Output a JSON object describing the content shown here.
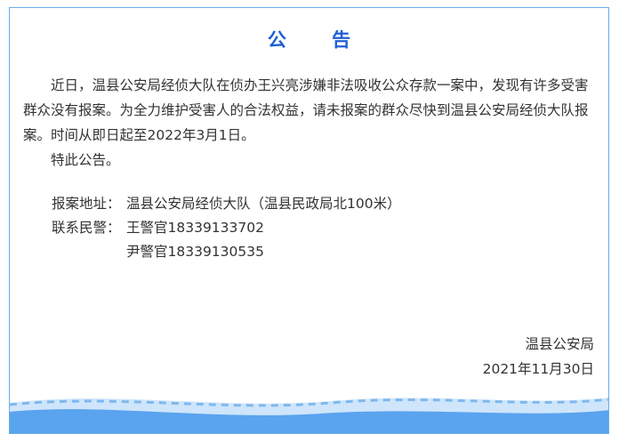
{
  "notice": {
    "title": "公 告",
    "paragraphs": [
      "近日，温县公安局经侦大队在侦办王兴亮涉嫌非法吸收公众存款一案中，发现有许多受害群众没有报案。为全力维护受害人的合法权益，请未报案的群众尽快到温县公安局经侦大队报案。时间从即日起至2022年3月1日。",
      "特此公告。"
    ],
    "address_label": "报案地址：",
    "address_value": "温县公安局经侦大队（温县民政局北100米）",
    "contact_label": "联系民警：",
    "contacts": [
      "王警官18339133702",
      "尹警官18339130535"
    ],
    "issuer": "温县公安局",
    "date": "2021年11月30日"
  },
  "colors": {
    "title": "#1f5fd6",
    "frame_border": "#6aaee8",
    "wave_fill": "#5aa3ee",
    "wave_light": "#cfe5fb",
    "wave_dash": "#ffffff"
  }
}
